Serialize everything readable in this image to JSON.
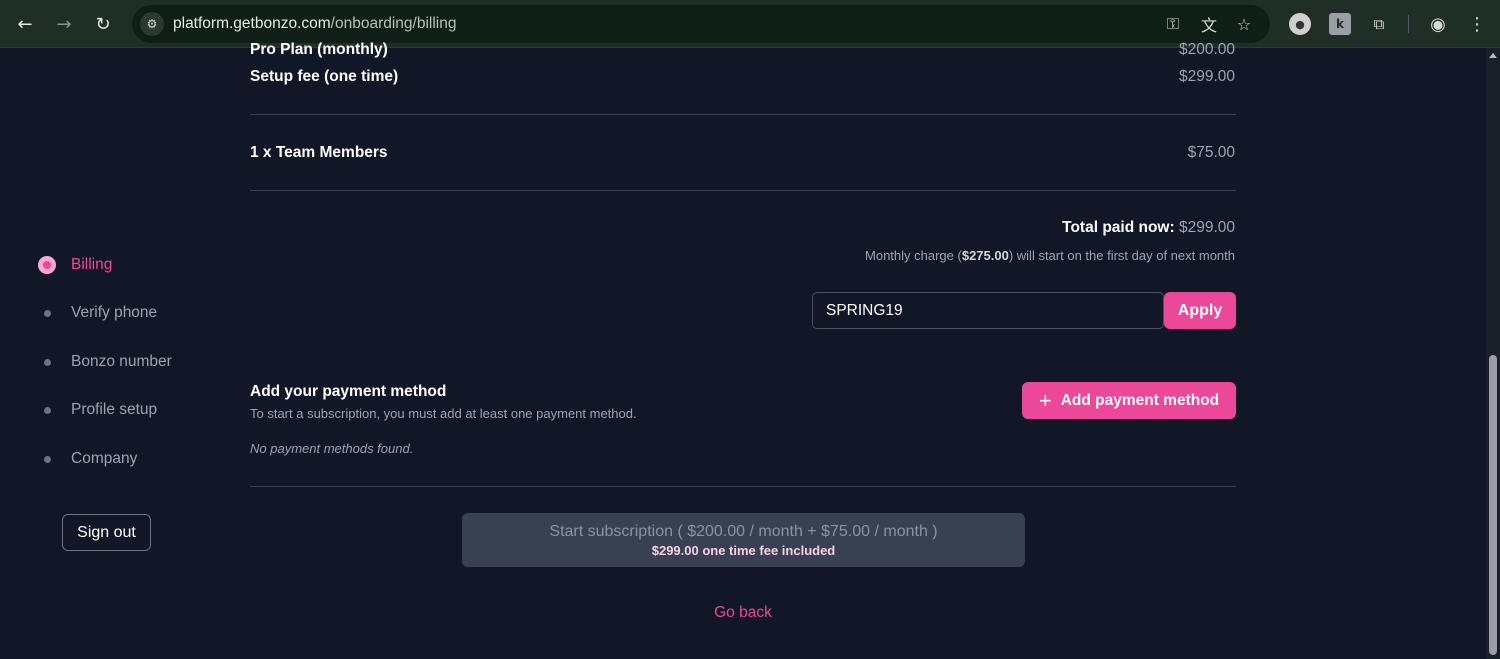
{
  "browser": {
    "url_domain": "platform.getbonzo.com",
    "url_path": "/onboarding/billing",
    "icons": [
      "back-arrow-icon",
      "forward-arrow-icon",
      "reload-icon",
      "site-settings-icon",
      "key-icon",
      "translate-icon",
      "star-icon",
      "extension-icon",
      "puzzle-icon",
      "profile-icon",
      "menu-icon"
    ]
  },
  "sidebar": {
    "steps": [
      {
        "label": "Billing",
        "active": true
      },
      {
        "label": "Verify phone",
        "active": false
      },
      {
        "label": "Bonzo number",
        "active": false
      },
      {
        "label": "Profile setup",
        "active": false
      },
      {
        "label": "Company",
        "active": false
      }
    ],
    "sign_out": "Sign out"
  },
  "summary": {
    "items": [
      {
        "label": "Pro Plan (monthly)",
        "amount": "$200.00"
      },
      {
        "label": "Setup fee (one time)",
        "amount": "$299.00"
      },
      {
        "label": "1 x Team Members",
        "amount": "$75.00"
      }
    ],
    "total_label": "Total paid now:",
    "total_value": "$299.00",
    "monthly_prefix": "Monthly charge (",
    "monthly_amount": "$275.00",
    "monthly_suffix": ") will start on the first day of next month"
  },
  "coupon": {
    "value": "SPRING19",
    "apply_label": "Apply"
  },
  "payment": {
    "title": "Add your payment method",
    "subtitle": "To start a subscription, you must add at least one payment method.",
    "empty": "No payment methods found.",
    "add_label": "Add payment method"
  },
  "subscribe": {
    "line1": "Start subscription ( $200.00 / month + $75.00 / month )",
    "line2": "$299.00 one time fee included"
  },
  "go_back": "Go back",
  "colors": {
    "accent": "#ec4899",
    "background": "#121728",
    "chrome": "#1f2f28"
  }
}
